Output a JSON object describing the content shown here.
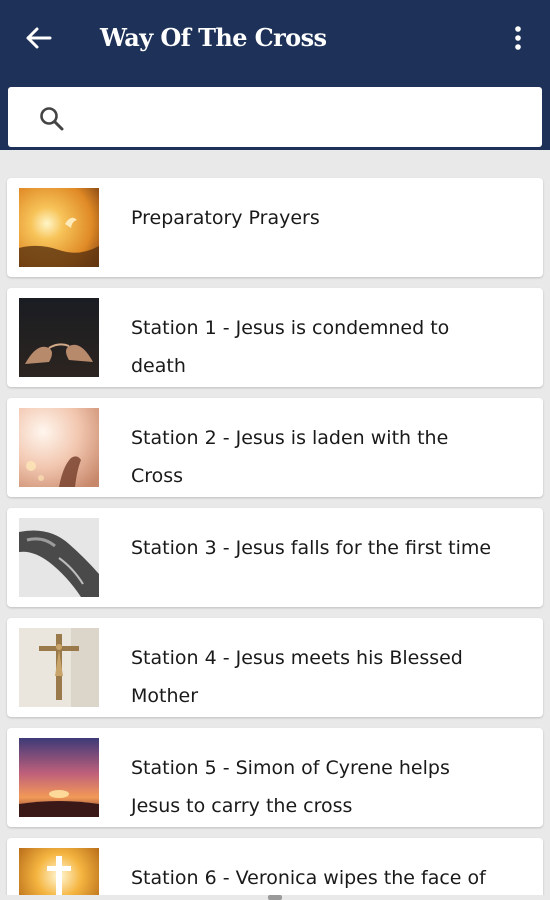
{
  "appbar": {
    "title": "Way Of The Cross",
    "back_icon": "arrow-left-icon",
    "menu_icon": "more-vertical-icon",
    "color": "#1e3158"
  },
  "search": {
    "placeholder": "",
    "value": "",
    "icon": "search-icon"
  },
  "items": [
    {
      "label": "Preparatory Prayers",
      "thumbnail": "sunset-dove-image"
    },
    {
      "label": "Station 1 - Jesus is condemned to death",
      "thumbnail": "praying-hands-image"
    },
    {
      "label": "Station 2 - Jesus is laden with the Cross",
      "thumbnail": "reaching-hand-light-image"
    },
    {
      "label": "Station 3 - Jesus falls for the first time",
      "thumbnail": "statue-grayscale-image"
    },
    {
      "label": "Station 4 - Jesus meets his Blessed Mother",
      "thumbnail": "crucifix-wall-image"
    },
    {
      "label": "Station 5 - Simon of Cyrene helps Jesus to carry the cross",
      "thumbnail": "sunset-sky-image"
    },
    {
      "label": "Station 6 - Veronica wipes the face of",
      "thumbnail": "glowing-cross-image"
    }
  ]
}
